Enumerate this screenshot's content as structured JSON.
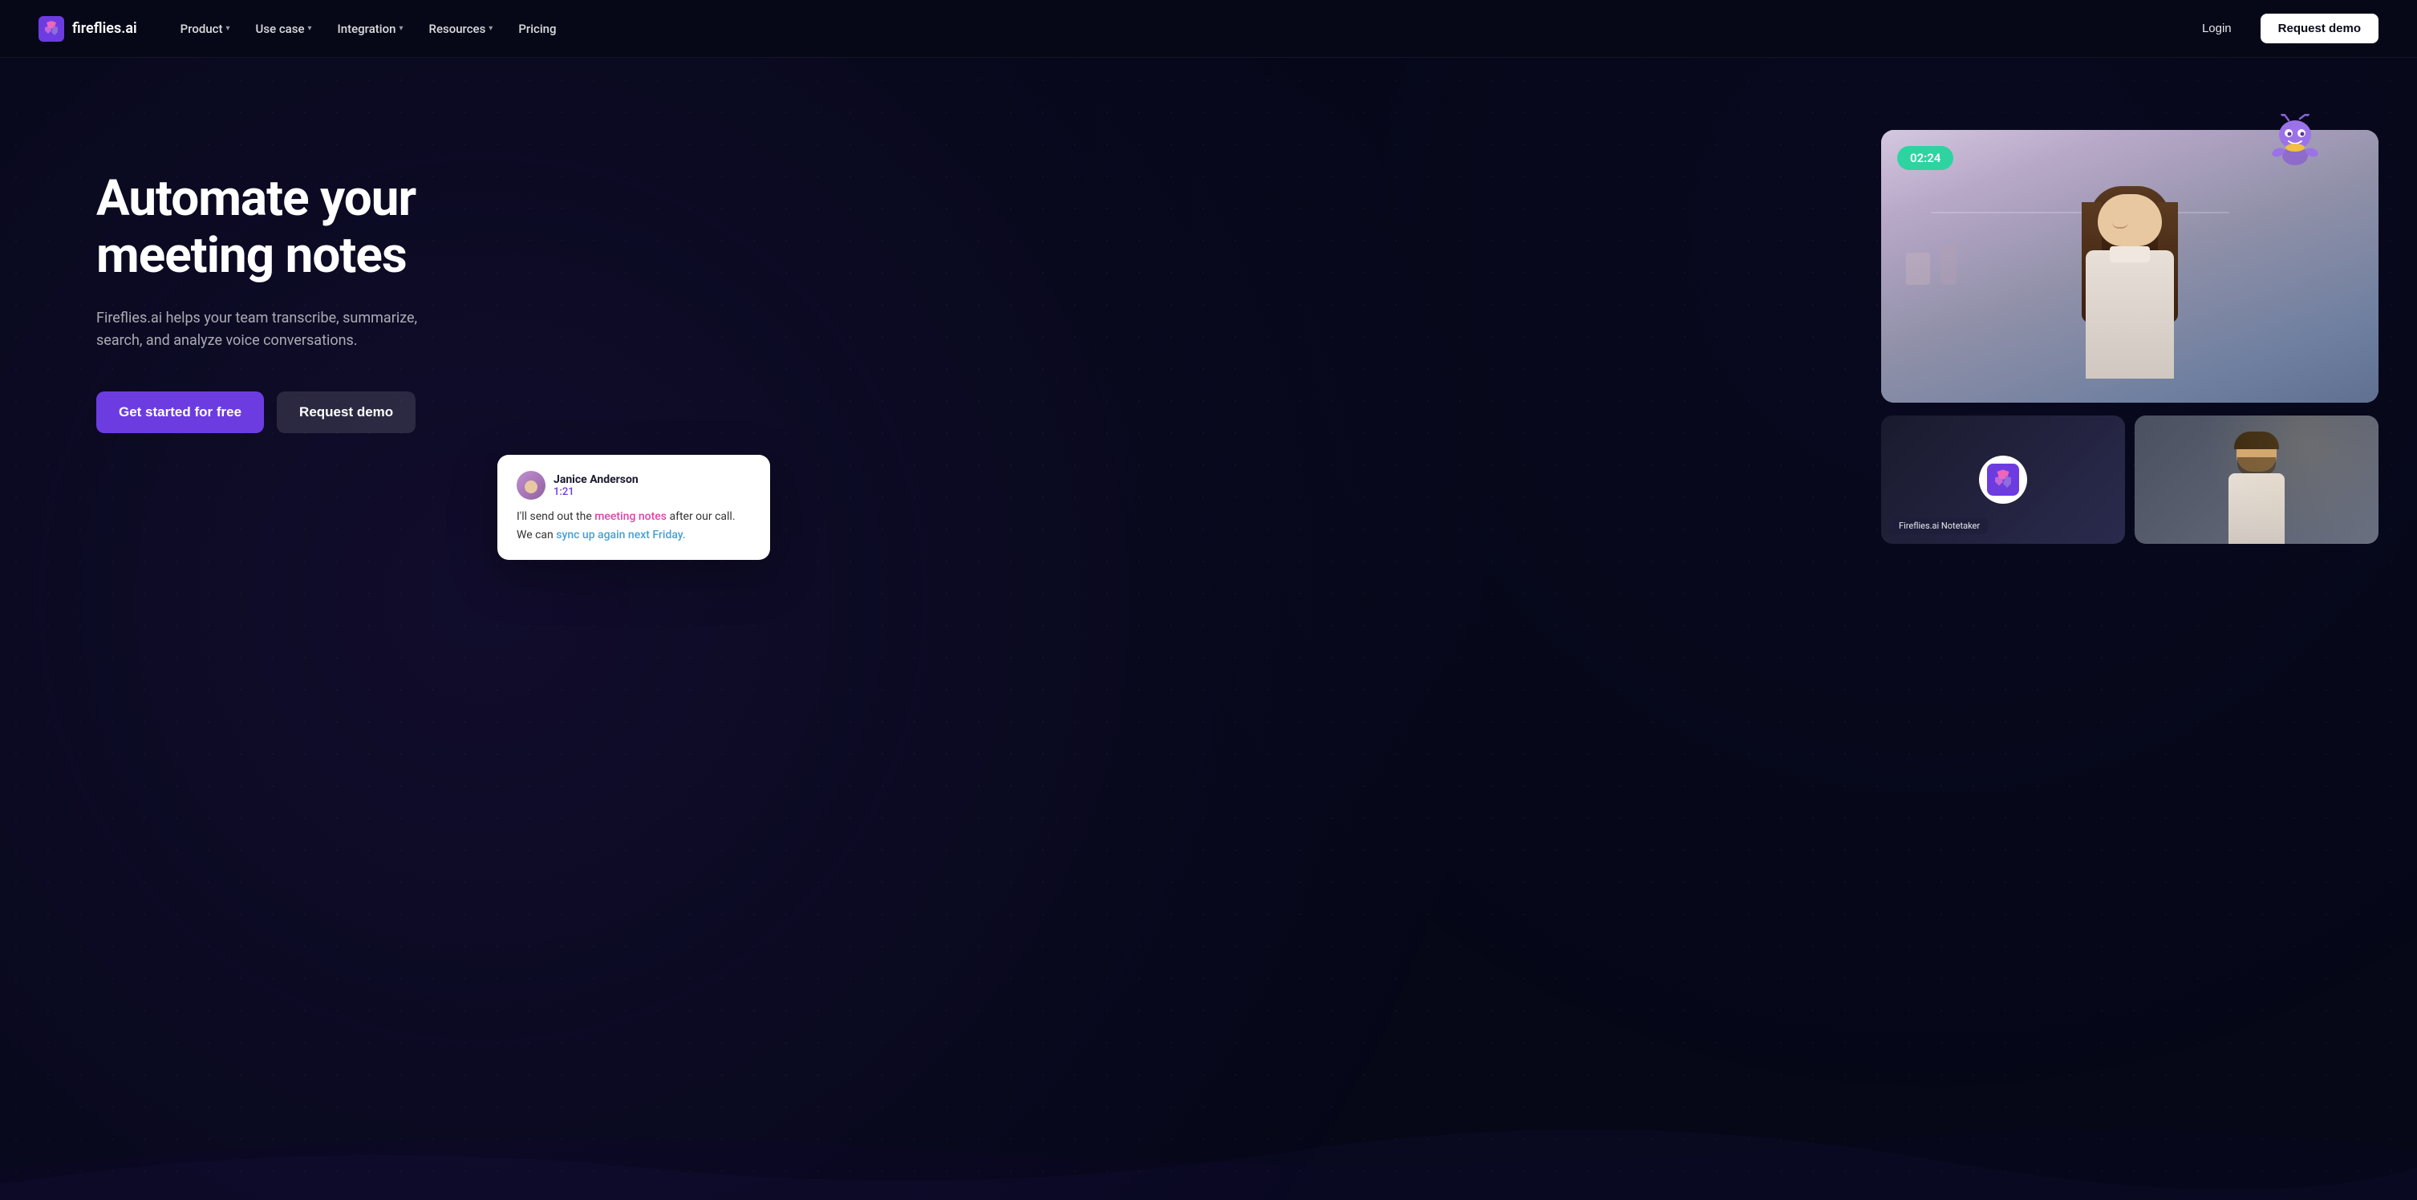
{
  "brand": {
    "name": "fireflies.ai",
    "logo_alt": "Fireflies.ai logo"
  },
  "navbar": {
    "product_label": "Product",
    "use_case_label": "Use case",
    "integration_label": "Integration",
    "resources_label": "Resources",
    "pricing_label": "Pricing",
    "login_label": "Login",
    "request_demo_label": "Request demo"
  },
  "hero": {
    "title": "Automate your meeting notes",
    "subtitle": "Fireflies.ai helps your team transcribe, summarize, search, and analyze voice conversations.",
    "cta_primary": "Get started for free",
    "cta_secondary": "Request demo"
  },
  "video": {
    "timer": "02:24",
    "speaker_name": "Janice Anderson",
    "speaker_time": "1:21",
    "transcript_line1_before": "I'll send out the ",
    "transcript_highlight1": "meeting notes",
    "transcript_line1_after": " after our call.",
    "transcript_line2_before": "We can ",
    "transcript_highlight2": "sync up again next Friday.",
    "notetaker_badge": "Fireflies.ai Notetaker"
  },
  "icons": {
    "chevron": "▾",
    "logo_shape": "F"
  }
}
